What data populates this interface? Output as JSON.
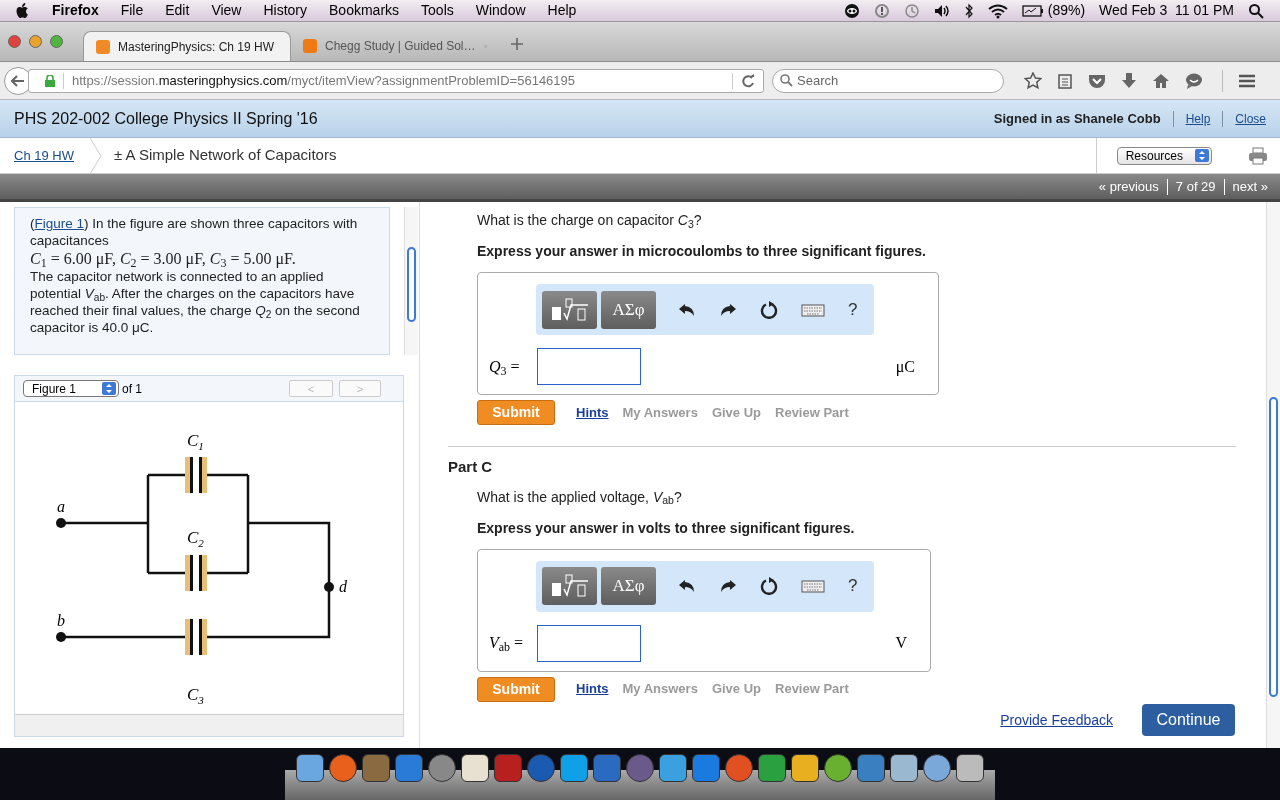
{
  "menubar": {
    "app": "Firefox",
    "menus": [
      "File",
      "Edit",
      "View",
      "History",
      "Bookmarks",
      "Tools",
      "Window",
      "Help"
    ],
    "battery": "(89%)",
    "clock": "Wed Feb 3  11 01 PM"
  },
  "tabs": [
    {
      "title": "MasteringPhysics: Ch 19 HW",
      "selected": true,
      "color": "#f08a24"
    },
    {
      "title": "Chegg Study | Guided Sol…",
      "selected": false,
      "color": "#f07a14"
    }
  ],
  "address": {
    "prefix": "https://session.",
    "domain": "masteringphysics.com",
    "path": "/myct/itemView?assignmentProblemID=56146195"
  },
  "search": {
    "placeholder": "Search"
  },
  "course": {
    "title": "PHS 202-002 College Physics II Spring '16",
    "signed_in": "Signed in as Shanele Cobb",
    "links": [
      "Help",
      "Close"
    ]
  },
  "breadcrumb": {
    "link": "Ch 19 HW",
    "title": "± A Simple Network of Capacitors",
    "resources": "Resources"
  },
  "pager": {
    "previous": "« previous",
    "position": "7 of 29",
    "next": "next »"
  },
  "problem": {
    "open": "(",
    "figure_link": "Figure 1",
    "intro": ") In the figure are shown three capacitors with capacitances",
    "values": "*C*$_{1}$ = 6.00 μF, *C*$_{2}$ = 3.00 μF, *C*$_{3}$ = 5.00 μF.",
    "body": "The capacitor network is connected to an applied potential *V*$_{ab}$. After the charges on the capacitors have reached their final values, the charge *Q*$_{2}$ on the second capacitor is 40.0 μC."
  },
  "figure": {
    "select": "Figure 1",
    "of": "of 1",
    "prev": "<",
    "next": ">",
    "c1": "C",
    "c1_sub": "1",
    "c2": "C",
    "c2_sub": "2",
    "c3": "C",
    "c3_sub": "3",
    "a": "a",
    "b": "b",
    "d": "d"
  },
  "parts": [
    {
      "question": "What is the charge on capacitor *C*$_{3}$?",
      "instruction": "Express your answer in microcoulombs to three significant figures.",
      "symbols": "ΑΣφ",
      "help": "?",
      "variable": "*Q*$_{3}$ =",
      "unit": "μC",
      "submit": "Submit",
      "links": [
        {
          "label": "Hints",
          "enabled": true
        },
        {
          "label": "My Answers",
          "enabled": false
        },
        {
          "label": "Give Up",
          "enabled": false
        },
        {
          "label": "Review Part",
          "enabled": false
        }
      ]
    },
    {
      "heading": "Part C",
      "question": "What is the applied voltage, *V*$_{ab}$?",
      "instruction": "Express your answer in volts to three significant figures.",
      "symbols": "ΑΣφ",
      "help": "?",
      "variable": "*V*$_{ab}$ =",
      "unit": "V",
      "submit": "Submit",
      "links": [
        {
          "label": "Hints",
          "enabled": true
        },
        {
          "label": "My Answers",
          "enabled": false
        },
        {
          "label": "Give Up",
          "enabled": false
        },
        {
          "label": "Review Part",
          "enabled": false
        }
      ]
    }
  ],
  "footer": {
    "feedback": "Provide Feedback",
    "continue": "Continue"
  }
}
